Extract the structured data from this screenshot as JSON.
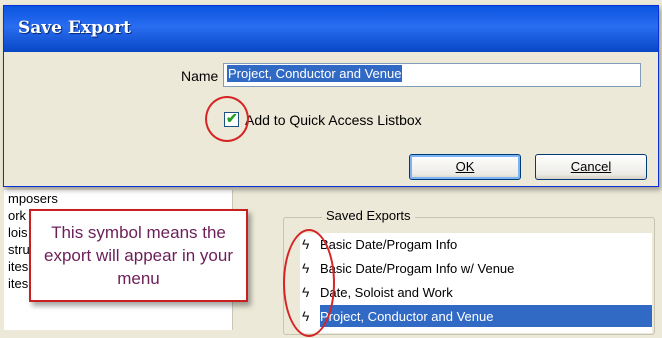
{
  "dialog": {
    "title": "Save Export",
    "name_label": "Name",
    "name_value": "Project, Conductor and Venue",
    "checkbox_label": "Add to Quick Access Listbox",
    "checkbox_checked": true,
    "ok_label": "OK",
    "cancel_label": "Cancel"
  },
  "background": {
    "left_list_rows": [
      "mposers",
      "ork",
      "lois",
      "stru",
      "ites",
      "ites"
    ],
    "saved_exports_label": "Saved Exports",
    "saved_exports": [
      {
        "label": "Basic Date/Progam Info",
        "icon": "lightning-bolt-icon"
      },
      {
        "label": "Basic Date/Progam Info w/ Venue",
        "icon": "lightning-bolt-icon"
      },
      {
        "label": "Date, Soloist and Work",
        "icon": "lightning-bolt-icon"
      },
      {
        "label": "Project, Conductor and Venue",
        "icon": "lightning-bolt-icon",
        "selected": true
      }
    ]
  },
  "annotation": {
    "callout_text": "This symbol means the export will appear in your menu",
    "color": "#d62525"
  },
  "colors": {
    "titlebar": "#0a55e0",
    "selection": "#316ac5",
    "callout_text": "#6b1f58"
  }
}
